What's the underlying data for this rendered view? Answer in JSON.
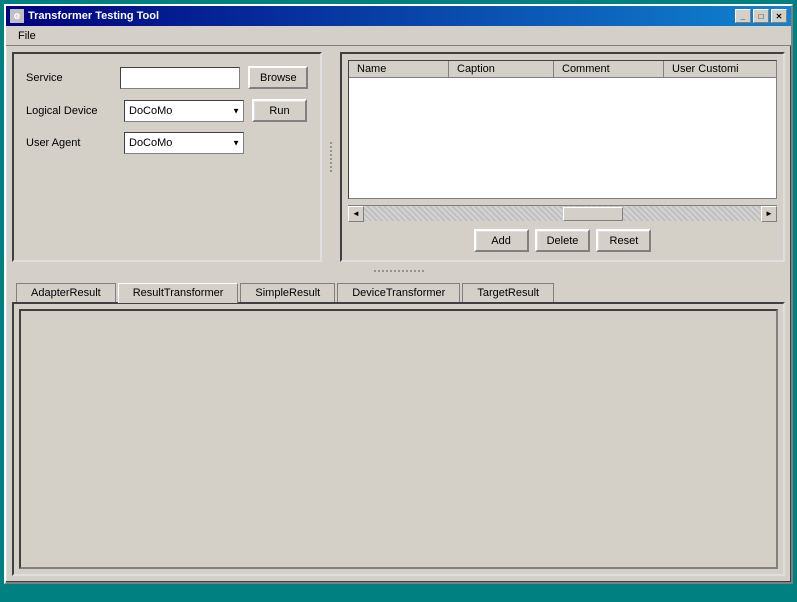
{
  "window": {
    "title": "Transformer Testing Tool",
    "title_icon": "⚙",
    "minimize_btn": "_",
    "maximize_btn": "□",
    "close_btn": "✕"
  },
  "menu": {
    "items": [
      {
        "label": "File"
      }
    ]
  },
  "left_panel": {
    "service_label": "Service",
    "service_placeholder": "",
    "browse_label": "Browse",
    "logical_device_label": "Logical Device",
    "logical_device_value": "DoCoMo",
    "logical_device_options": [
      "DoCoMo"
    ],
    "run_label": "Run",
    "user_agent_label": "User Agent",
    "user_agent_value": "DoCoMo",
    "user_agent_options": [
      "DoCoMo"
    ]
  },
  "right_panel": {
    "table_columns": [
      "Name",
      "Caption",
      "Comment",
      "User Customi"
    ],
    "add_label": "Add",
    "delete_label": "Delete",
    "reset_label": "Reset"
  },
  "tabs": [
    {
      "id": "adapter",
      "label": "AdapterResult",
      "active": false
    },
    {
      "id": "result",
      "label": "ResultTransformer",
      "active": true
    },
    {
      "id": "simple",
      "label": "SimpleResult",
      "active": false
    },
    {
      "id": "device",
      "label": "DeviceTransformer",
      "active": false
    },
    {
      "id": "target",
      "label": "TargetResult",
      "active": false
    }
  ]
}
